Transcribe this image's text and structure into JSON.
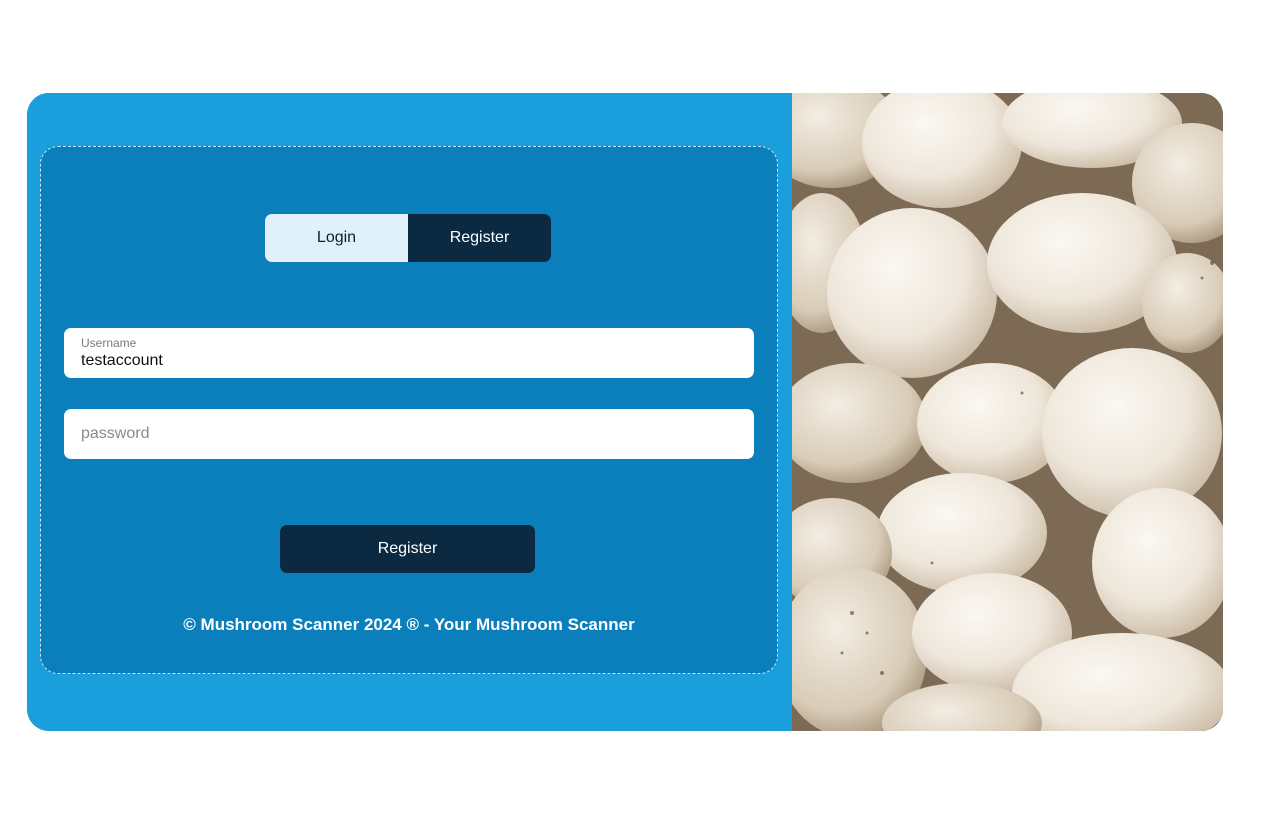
{
  "auth_toggle": {
    "login_label": "Login",
    "register_label": "Register",
    "active": "register"
  },
  "form": {
    "username": {
      "label": "Username",
      "value": "testaccount"
    },
    "password": {
      "placeholder": "password",
      "value": ""
    },
    "submit_label": "Register"
  },
  "footer": {
    "text": "© Mushroom Scanner 2024 ® - Your Mushroom Scanner"
  },
  "image": {
    "subject": "white mushrooms photo"
  },
  "colors": {
    "panel_outer": "#1a9fdc",
    "panel_inner": "#0b7fbc",
    "dark_navy": "#0b2a42",
    "toggle_light": "#e0f1fc"
  }
}
